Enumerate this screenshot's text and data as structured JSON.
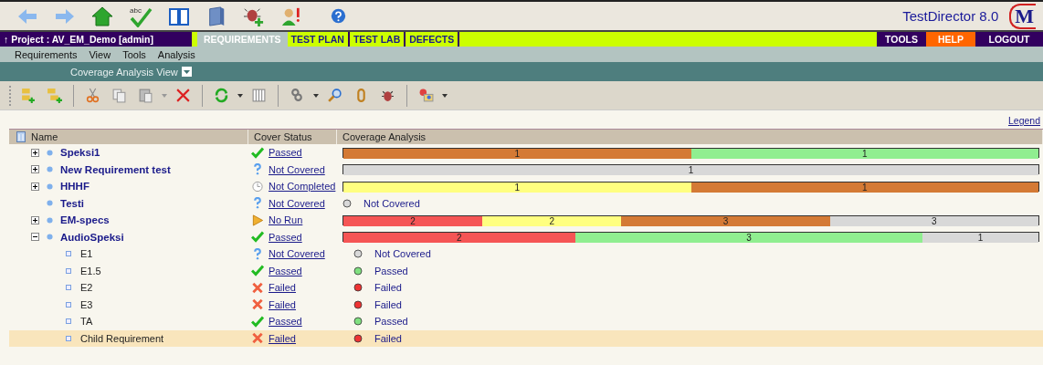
{
  "header": {
    "spellcheck_label": "abc",
    "product": "TestDirector 8.0",
    "logo_text": "M"
  },
  "nav": {
    "project": "↑ Project : AV_EM_Demo [admin]",
    "tabs": [
      {
        "label": "REQUIREMENTS",
        "selected": true
      },
      {
        "label": "TEST PLAN",
        "selected": false
      },
      {
        "label": "TEST LAB",
        "selected": false
      },
      {
        "label": "DEFECTS",
        "selected": false
      }
    ],
    "links": [
      {
        "label": "TOOLS",
        "color": "#32005f"
      },
      {
        "label": "HELP",
        "color": "#ff6600"
      },
      {
        "label": "LOGOUT",
        "color": "#32005f"
      }
    ]
  },
  "menu": [
    "Requirements",
    "View",
    "Tools",
    "Analysis"
  ],
  "view_selector": {
    "label": "Coverage Analysis View"
  },
  "legend_link": "Legend",
  "table": {
    "columns": [
      "Name",
      "Cover Status",
      "Coverage Analysis"
    ],
    "rows": [
      {
        "name": "Speksi1",
        "expanded": false,
        "selected": false,
        "status": {
          "kind": "passed",
          "label": "Passed"
        },
        "analysis": {
          "segments": [
            {
              "count": "1",
              "color": "#d47a35"
            },
            {
              "count": "1",
              "color": "#90ee90"
            }
          ]
        }
      },
      {
        "name": "New Requirement test",
        "expanded": false,
        "selected": false,
        "status": {
          "kind": "not_covered",
          "label": "Not Covered"
        },
        "analysis": {
          "segments": [
            {
              "count": "1",
              "color": "#d8d8d8"
            }
          ]
        }
      },
      {
        "name": "HHHF",
        "expanded": false,
        "selected": false,
        "status": {
          "kind": "not_completed",
          "label": "Not Completed"
        },
        "analysis": {
          "segments": [
            {
              "count": "1",
              "color": "#ffff80"
            },
            {
              "count": "1",
              "color": "#d47a35"
            }
          ]
        }
      },
      {
        "name": "Testi",
        "selected": false,
        "status": {
          "kind": "not_covered",
          "label": "Not Covered"
        },
        "analysis": {
          "color": "#d8d8d8",
          "label": "Not Covered"
        }
      },
      {
        "name": "EM-specs",
        "expanded": false,
        "selected": false,
        "status": {
          "kind": "no_run",
          "label": "No Run"
        },
        "analysis": {
          "segments": [
            {
              "count": "2",
              "color": "#f55555"
            },
            {
              "count": "2",
              "color": "#ffff80"
            },
            {
              "count": "3",
              "color": "#d47a35"
            },
            {
              "count": "3",
              "color": "#d8d8d8"
            }
          ]
        }
      },
      {
        "name": "AudioSpeksi",
        "expanded": true,
        "selected": false,
        "status": {
          "kind": "passed",
          "label": "Passed"
        },
        "analysis": {
          "segments": [
            {
              "count": "2",
              "color": "#f55555"
            },
            {
              "count": "3",
              "color": "#90ee90"
            },
            {
              "count": "1",
              "color": "#d8d8d8"
            }
          ]
        },
        "children": [
          {
            "name": "E1",
            "selected": false,
            "status": {
              "kind": "not_covered",
              "label": "Not Covered"
            },
            "analysis": {
              "color": "#d8d8d8",
              "label": "Not Covered"
            }
          },
          {
            "name": "E1.5",
            "selected": false,
            "status": {
              "kind": "passed",
              "label": "Passed"
            },
            "analysis": {
              "color": "#80e080",
              "label": "Passed"
            }
          },
          {
            "name": "E2",
            "selected": false,
            "status": {
              "kind": "failed",
              "label": "Failed"
            },
            "analysis": {
              "color": "#ee3333",
              "label": "Failed"
            }
          },
          {
            "name": "E3",
            "selected": false,
            "status": {
              "kind": "failed",
              "label": "Failed"
            },
            "analysis": {
              "color": "#ee3333",
              "label": "Failed"
            }
          },
          {
            "name": "TA",
            "selected": false,
            "status": {
              "kind": "passed",
              "label": "Passed"
            },
            "analysis": {
              "color": "#80e080",
              "label": "Passed"
            }
          },
          {
            "name": "Child Requirement",
            "selected": true,
            "status": {
              "kind": "failed",
              "label": "Failed"
            },
            "analysis": {
              "color": "#ee3333",
              "label": "Failed"
            }
          }
        ]
      }
    ]
  }
}
